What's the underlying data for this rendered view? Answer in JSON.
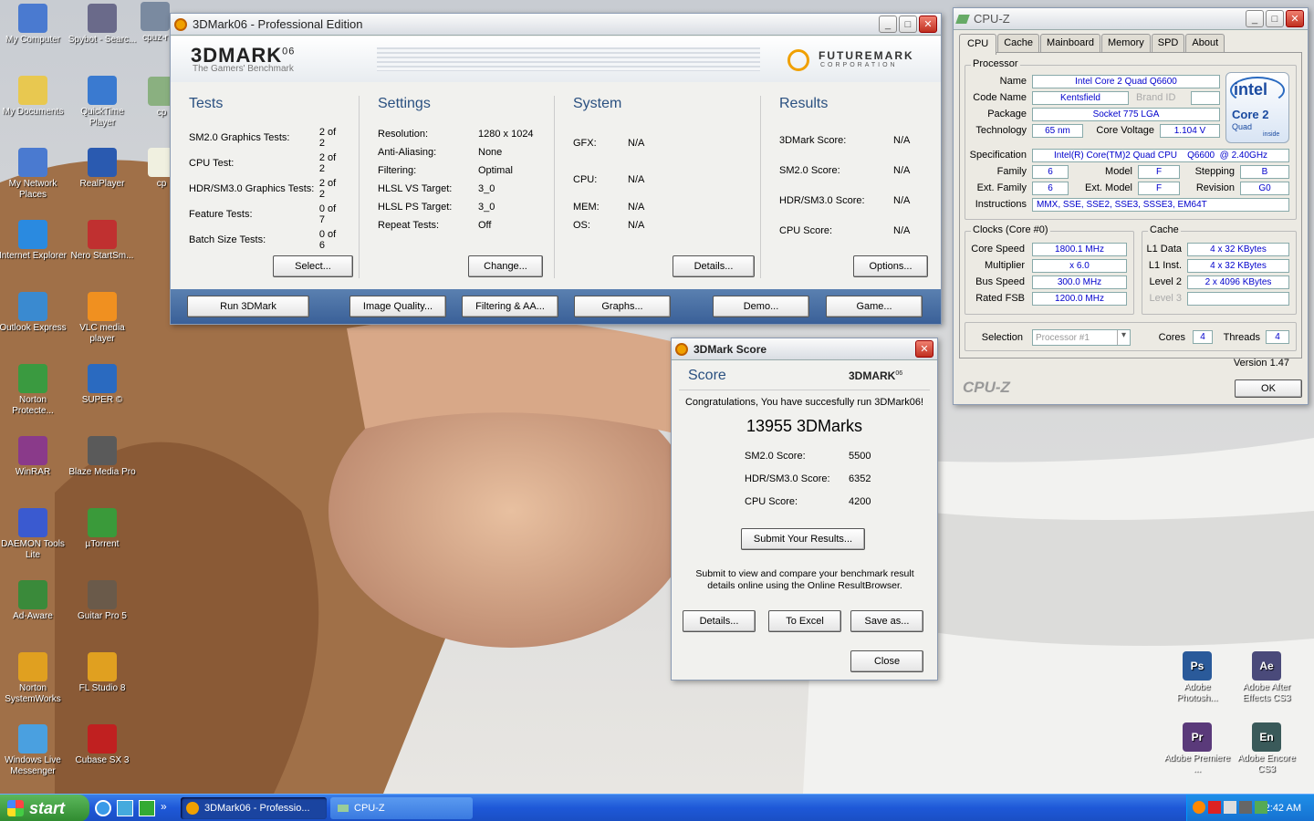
{
  "desktop": {
    "icons_left": [
      {
        "label": "My Computer",
        "color": "#4a7ad0"
      },
      {
        "label": "My Documents",
        "color": "#e8c850"
      },
      {
        "label": "My Network Places",
        "color": "#4a7ad0"
      },
      {
        "label": "Internet Explorer",
        "color": "#2a8ae0"
      },
      {
        "label": "Outlook Express",
        "color": "#3a8ad0"
      },
      {
        "label": "Norton Protecte...",
        "color": "#3a9a40"
      },
      {
        "label": "WinRAR",
        "color": "#8a3a8a"
      },
      {
        "label": "DAEMON Tools Lite",
        "color": "#3a5ad0"
      },
      {
        "label": "Ad-Aware",
        "color": "#3a8a3a"
      },
      {
        "label": "Norton SystemWorks",
        "color": "#e0a020"
      },
      {
        "label": "Windows Live Messenger",
        "color": "#4aa0e0"
      }
    ],
    "icons_right": [
      {
        "label": "Spybot - Searc...",
        "color": "#6a6a8a"
      },
      {
        "label": "QuickTime Player",
        "color": "#3a7ad0"
      },
      {
        "label": "RealPlayer",
        "color": "#2a5ab0"
      },
      {
        "label": "Nero StartSm...",
        "color": "#c03030"
      },
      {
        "label": "VLC media player",
        "color": "#f09020"
      },
      {
        "label": "SUPER ©",
        "color": "#2a6ac0"
      },
      {
        "label": "Blaze Media Pro",
        "color": "#5a5a5a"
      },
      {
        "label": "µTorrent",
        "color": "#3a9a3a"
      },
      {
        "label": "Guitar Pro 5",
        "color": "#6a5a4a"
      },
      {
        "label": "FL Studio 8",
        "color": "#e0a020"
      },
      {
        "label": "Cubase SX 3",
        "color": "#c02020"
      }
    ],
    "partial_icons": [
      "cpuz-r",
      "cp",
      "cp"
    ],
    "adobe_icons": [
      {
        "code": "Ps",
        "label": "Adobe Photosh...",
        "color": "#2a5a9a"
      },
      {
        "code": "Ae",
        "label": "Adobe After Effects CS3",
        "color": "#4a4a7a"
      },
      {
        "code": "Pr",
        "label": "Adobe Premiere ...",
        "color": "#5a3a7a"
      },
      {
        "code": "En",
        "label": "Adobe Encore CS3",
        "color": "#3a5a5a"
      }
    ]
  },
  "mark": {
    "title": "3DMark06 - Professional Edition",
    "logo": "3DMARK",
    "logo_sup": "06",
    "tagline": "The Gamers' Benchmark",
    "brand": "FUTUREMARK",
    "brand_sub": "CORPORATION",
    "tests": {
      "heading": "Tests",
      "rows": [
        [
          "SM2.0 Graphics Tests:",
          "2 of 2"
        ],
        [
          "CPU Test:",
          "2 of 2"
        ],
        [
          "HDR/SM3.0 Graphics Tests:",
          "2 of 2"
        ],
        [
          "Feature Tests:",
          "0 of 7"
        ],
        [
          "Batch Size Tests:",
          "0 of 6"
        ]
      ],
      "button": "Select..."
    },
    "settings": {
      "heading": "Settings",
      "rows": [
        [
          "Resolution:",
          "1280 x 1024"
        ],
        [
          "Anti-Aliasing:",
          "None"
        ],
        [
          "Filtering:",
          "Optimal"
        ],
        [
          "HLSL VS Target:",
          "3_0"
        ],
        [
          "HLSL PS Target:",
          "3_0"
        ],
        [
          "Repeat Tests:",
          "Off"
        ]
      ],
      "button": "Change..."
    },
    "system": {
      "heading": "System",
      "rows": [
        [
          "GFX:",
          "N/A"
        ],
        [
          "CPU:",
          "N/A"
        ],
        [
          "MEM:",
          "N/A"
        ],
        [
          "OS:",
          "N/A"
        ]
      ],
      "button": "Details..."
    },
    "results": {
      "heading": "Results",
      "rows": [
        [
          "3DMark Score:",
          "N/A"
        ],
        [
          "SM2.0 Score:",
          "N/A"
        ],
        [
          "HDR/SM3.0 Score:",
          "N/A"
        ],
        [
          "CPU Score:",
          "N/A"
        ]
      ],
      "button": "Options..."
    },
    "bottom": [
      "Run 3DMark",
      "Image Quality...",
      "Filtering & AA...",
      "Graphs...",
      "Demo...",
      "Game..."
    ]
  },
  "score": {
    "title": "3DMark Score",
    "heading": "Score",
    "logo": "3DMARK",
    "logo_sup": "06",
    "congrats": "Congratulations, You have succesfully run 3DMark06!",
    "total": "13955 3DMarks",
    "rows": [
      [
        "SM2.0 Score:",
        "5500"
      ],
      [
        "HDR/SM3.0 Score:",
        "6352"
      ],
      [
        "CPU Score:",
        "4200"
      ]
    ],
    "submit": "Submit Your Results...",
    "note": "Submit to view and compare your benchmark result details online using the Online ResultBrowser.",
    "details": "Details...",
    "excel": "To Excel",
    "save": "Save as...",
    "close": "Close"
  },
  "cpuz": {
    "title": "CPU-Z",
    "tabs": [
      "CPU",
      "Cache",
      "Mainboard",
      "Memory",
      "SPD",
      "About"
    ],
    "processor": "Processor",
    "name_l": "Name",
    "name": "Intel Core 2 Quad Q6600",
    "code_l": "Code Name",
    "code": "Kentsfield",
    "brand_l": "Brand ID",
    "pkg_l": "Package",
    "pkg": "Socket 775 LGA",
    "tech_l": "Technology",
    "tech": "65 nm",
    "volt_l": "Core Voltage",
    "volt": "1.104 V",
    "spec_l": "Specification",
    "spec": "Intel(R) Core(TM)2 Quad CPU    Q6600  @ 2.40GHz",
    "fam_l": "Family",
    "fam": "6",
    "model_l": "Model",
    "model": "F",
    "step_l": "Stepping",
    "step": "B",
    "efam_l": "Ext. Family",
    "efam": "6",
    "emodel_l": "Ext. Model",
    "emodel": "F",
    "rev_l": "Revision",
    "rev": "G0",
    "instr_l": "Instructions",
    "instr": "MMX, SSE, SSE2, SSE3, SSSE3, EM64T",
    "clocks": "Clocks (Core #0)",
    "cs_l": "Core Speed",
    "cs": "1800.1 MHz",
    "mul_l": "Multiplier",
    "mul": "x 6.0",
    "bus_l": "Bus Speed",
    "bus": "300.0 MHz",
    "fsb_l": "Rated FSB",
    "fsb": "1200.0 MHz",
    "cache": "Cache",
    "l1d_l": "L1 Data",
    "l1d": "4 x 32 KBytes",
    "l1i_l": "L1 Inst.",
    "l1i": "4 x 32 KBytes",
    "l2_l": "Level 2",
    "l2": "2 x 4096 KBytes",
    "l3_l": "Level 3",
    "sel_l": "Selection",
    "sel": "Processor #1",
    "cores_l": "Cores",
    "cores": "4",
    "thr_l": "Threads",
    "thr": "4",
    "version": "Version 1.47",
    "footer": "CPU-Z",
    "ok": "OK",
    "intel": "intel",
    "core2": "Core 2",
    "quad": "Quad",
    "inside": "inside"
  },
  "taskbar": {
    "start": "start",
    "task1": "3DMark06 - Professio...",
    "task2": "CPU-Z",
    "time": "2:42 AM",
    "quick": "»"
  }
}
